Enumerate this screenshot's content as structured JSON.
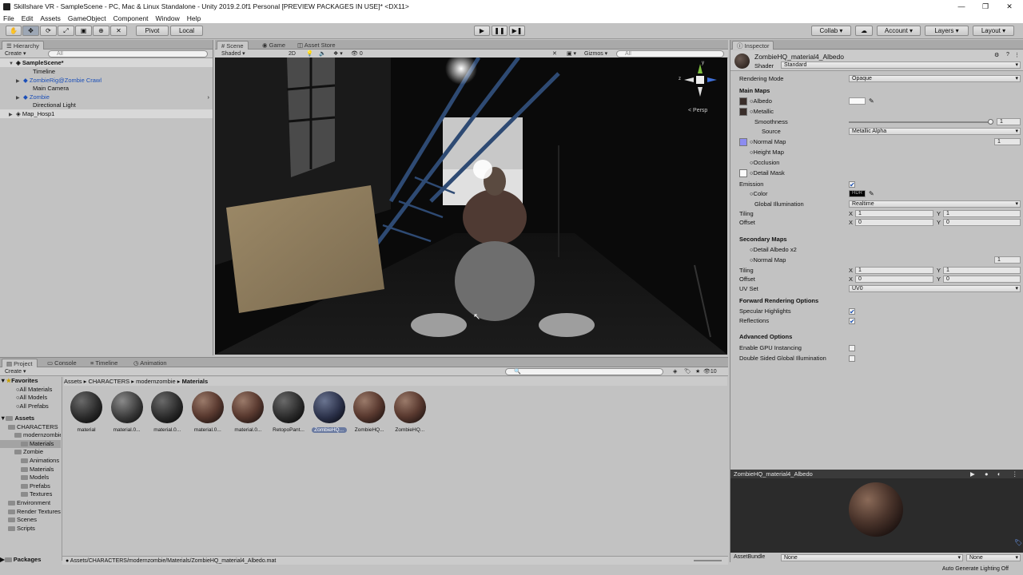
{
  "window": {
    "title": "Skillshare VR - SampleScene - PC, Mac & Linux Standalone - Unity 2019.2.0f1 Personal [PREVIEW PACKAGES IN USE]* <DX11>",
    "controls": [
      "—",
      "❐",
      "✕"
    ]
  },
  "menu": [
    "File",
    "Edit",
    "Assets",
    "GameObject",
    "Component",
    "Window",
    "Help"
  ],
  "toolbar": {
    "pivot": "Pivot",
    "local": "Local",
    "collab": "Collab ▾",
    "account": "Account",
    "layers": "Layers",
    "layout": "Layout"
  },
  "hierarchy": {
    "tab": "Hierarchy",
    "create": "Create ▾",
    "search_placeholder": "All",
    "items": [
      {
        "label": "SampleScene*",
        "level": 0,
        "style": "bold"
      },
      {
        "label": "Timeline",
        "level": 2,
        "style": "normal"
      },
      {
        "label": "ZombieRig@Zombie Crawl",
        "level": 2,
        "style": "blue"
      },
      {
        "label": "Main Camera",
        "level": 2,
        "style": "normal"
      },
      {
        "label": "Zombie",
        "level": 2,
        "style": "blue"
      },
      {
        "label": "Directional Light",
        "level": 2,
        "style": "normal"
      },
      {
        "label": "Map_Hosp1",
        "level": 1,
        "style": "normal"
      }
    ]
  },
  "scene": {
    "tabs": [
      "Scene",
      "Game",
      "Asset Store"
    ],
    "shading": "Shaded",
    "mode_2d": "2D",
    "fx_count": "0",
    "gizmos": "Gizmos",
    "search_placeholder": "All",
    "persp": "< Persp",
    "axis_x": "x",
    "axis_y": "y",
    "axis_z": "z"
  },
  "project": {
    "tabs": [
      "Project",
      "Console",
      "Timeline",
      "Animation"
    ],
    "create": "Create ▾",
    "breadcrumb": [
      "Assets",
      "CHARACTERS",
      "modernzombie",
      "Materials"
    ],
    "count": "10",
    "favorites_label": "Favorites",
    "favorites": [
      "All Materials",
      "All Models",
      "All Prefabs"
    ],
    "assets_label": "Assets",
    "tree": [
      {
        "label": "CHARACTERS",
        "indent": 1
      },
      {
        "label": "modernzombie",
        "indent": 2
      },
      {
        "label": "Materials",
        "indent": 3,
        "selected": true
      },
      {
        "label": "Zombie",
        "indent": 2
      },
      {
        "label": "Animations",
        "indent": 3
      },
      {
        "label": "Materials",
        "indent": 3
      },
      {
        "label": "Models",
        "indent": 3
      },
      {
        "label": "Prefabs",
        "indent": 3
      },
      {
        "label": "Textures",
        "indent": 3
      },
      {
        "label": "Environment",
        "indent": 1
      },
      {
        "label": "Render Textures",
        "indent": 1
      },
      {
        "label": "Scenes",
        "indent": 1
      },
      {
        "label": "Scripts",
        "indent": 1
      }
    ],
    "packages_label": "Packages",
    "assets": [
      {
        "label": "material",
        "tex": "dark"
      },
      {
        "label": "material.0...",
        "tex": "grey"
      },
      {
        "label": "material.0...",
        "tex": "dark"
      },
      {
        "label": "material.0...",
        "tex": "rust"
      },
      {
        "label": "material.0...",
        "tex": "rust"
      },
      {
        "label": "RetopoPant...",
        "tex": "dark"
      },
      {
        "label": "ZombieHQ...",
        "tex": "blue",
        "selected": true
      },
      {
        "label": "ZombieHQ...",
        "tex": "rust"
      },
      {
        "label": "ZombieHQ...",
        "tex": "rust"
      }
    ],
    "status_path": "Assets/CHARACTERS/modernzombie/Materials/ZombieHQ_material4_Albedo.mat"
  },
  "inspector": {
    "tab": "Inspector",
    "material_name": "ZombieHQ_material4_Albedo",
    "shader_label": "Shader",
    "shader_value": "Standard",
    "rendering_mode_label": "Rendering Mode",
    "rendering_mode_value": "Opaque",
    "main_maps": "Main Maps",
    "albedo": "Albedo",
    "metallic": "Metallic",
    "smoothness": "Smoothness",
    "smoothness_value": "1",
    "source": "Source",
    "source_value": "Metallic Alpha",
    "normal_map": "Normal Map",
    "normal_value": "1",
    "height_map": "Height Map",
    "occlusion": "Occlusion",
    "detail_mask": "Detail Mask",
    "emission": "Emission",
    "color": "Color",
    "hdr": "HDR",
    "gi_label": "Global Illumination",
    "gi_value": "Realtime",
    "tiling": "Tiling",
    "offset": "Offset",
    "x": "X",
    "y": "Y",
    "tiling_x": "1",
    "tiling_y": "1",
    "offset_x": "0",
    "offset_y": "0",
    "secondary_maps": "Secondary Maps",
    "detail_albedo": "Detail Albedo x2",
    "normal_map2": "Normal Map",
    "normal2_value": "1",
    "tiling2_x": "1",
    "tiling2_y": "1",
    "offset2_x": "0",
    "offset2_y": "0",
    "uv_set": "UV Set",
    "uv_set_value": "UV0",
    "forward_options": "Forward Rendering Options",
    "specular_highlights": "Specular Highlights",
    "reflections": "Reflections",
    "advanced": "Advanced Options",
    "gpu_instancing": "Enable GPU Instancing",
    "double_sided_gi": "Double Sided Global Illumination",
    "preview_title": "ZombieHQ_material4_Albedo",
    "assetbundle_label": "AssetBundle",
    "assetbundle_value": "None",
    "assetbundle_variant": "None",
    "auto_lighting": "Auto Generate Lighting Off"
  }
}
